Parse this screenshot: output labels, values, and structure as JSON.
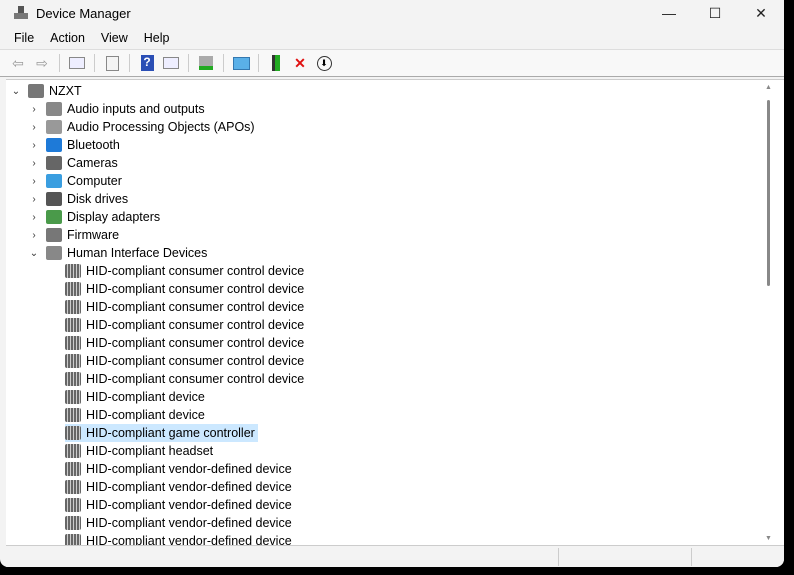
{
  "window": {
    "title": "Device Manager",
    "minimize": "—",
    "maximize": "☐",
    "close": "✕"
  },
  "menu": [
    "File",
    "Action",
    "View",
    "Help"
  ],
  "toolbar": {
    "back": "⇦",
    "forward": "⇨",
    "help": "?",
    "uninstall": "✕",
    "download": "⬇"
  },
  "tree": {
    "root": "NZXT",
    "categories": [
      "Audio inputs and outputs",
      "Audio Processing Objects (APOs)",
      "Bluetooth",
      "Cameras",
      "Computer",
      "Disk drives",
      "Display adapters",
      "Firmware",
      "Human Interface Devices"
    ],
    "hid_children": [
      "HID-compliant consumer control device",
      "HID-compliant consumer control device",
      "HID-compliant consumer control device",
      "HID-compliant consumer control device",
      "HID-compliant consumer control device",
      "HID-compliant consumer control device",
      "HID-compliant consumer control device",
      "HID-compliant device",
      "HID-compliant device",
      "HID-compliant game controller",
      "HID-compliant headset",
      "HID-compliant vendor-defined device",
      "HID-compliant vendor-defined device",
      "HID-compliant vendor-defined device",
      "HID-compliant vendor-defined device",
      "HID-compliant vendor-defined device"
    ],
    "selected": "HID-compliant game controller"
  },
  "colors": {
    "selection": "#cce8ff",
    "accent": "#0078d4"
  }
}
